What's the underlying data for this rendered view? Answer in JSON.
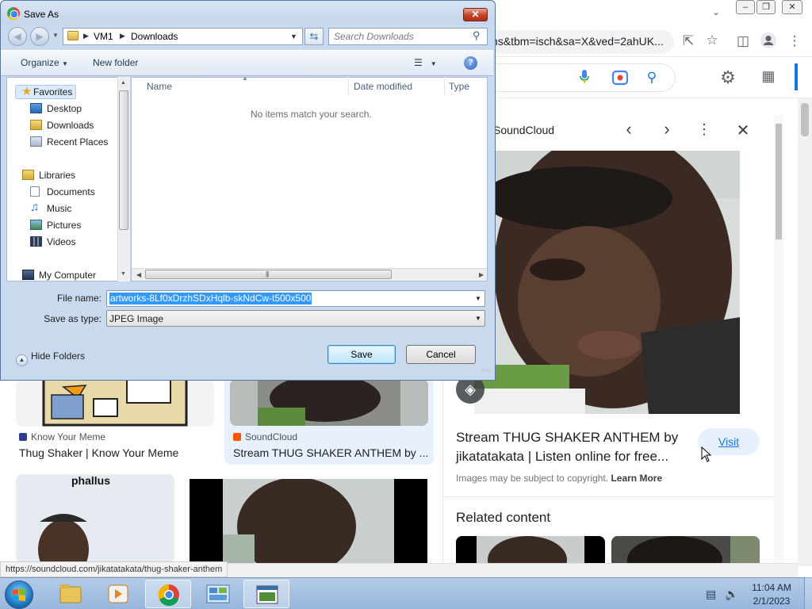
{
  "browser": {
    "omnibox_text": "ns&tbm=isch&sa=X&ved=2ahUK...",
    "status_url": "https://soundcloud.com/jikatatakata/thug-shaker-anthem"
  },
  "results": [
    {
      "source": "Know Your Meme",
      "title": "Thug Shaker | Know Your Meme",
      "source_color": "#2c3e8f"
    },
    {
      "source": "SoundCloud",
      "title": "Stream THUG SHAKER ANTHEM by ...",
      "source_color": "#ff5500"
    },
    {
      "overlay_text": "phallus"
    }
  ],
  "panel": {
    "source": "SoundCloud",
    "title": "Stream THUG SHAKER ANTHEM by jikatatakata | Listen online for free...",
    "visit_label": "Visit",
    "copyright": "Images may be subject to copyright.",
    "learn_more": "Learn More",
    "related_label": "Related content"
  },
  "taskbar": {
    "time": "11:04 AM",
    "date": "2/1/2023"
  },
  "dialog": {
    "title": "Save As",
    "breadcrumb": [
      "VM1",
      "Downloads"
    ],
    "search_placeholder": "Search Downloads",
    "toolbar": {
      "organize": "Organize",
      "new_folder": "New folder"
    },
    "nav": {
      "favorites": "Favorites",
      "desktop": "Desktop",
      "downloads": "Downloads",
      "recent": "Recent Places",
      "libraries": "Libraries",
      "documents": "Documents",
      "music": "Music",
      "pictures": "Pictures",
      "videos": "Videos",
      "computer": "My Computer"
    },
    "columns": {
      "name": "Name",
      "date": "Date modified",
      "type": "Type"
    },
    "empty_message": "No items match your search.",
    "file_name_label": "File name:",
    "file_name_value": "artworks-8Lf0xDrzhSDxHqlb-skNdCw-t500x500",
    "save_type_label": "Save as type:",
    "save_type_value": "JPEG Image",
    "hide_folders": "Hide Folders",
    "save_button": "Save",
    "cancel_button": "Cancel"
  }
}
